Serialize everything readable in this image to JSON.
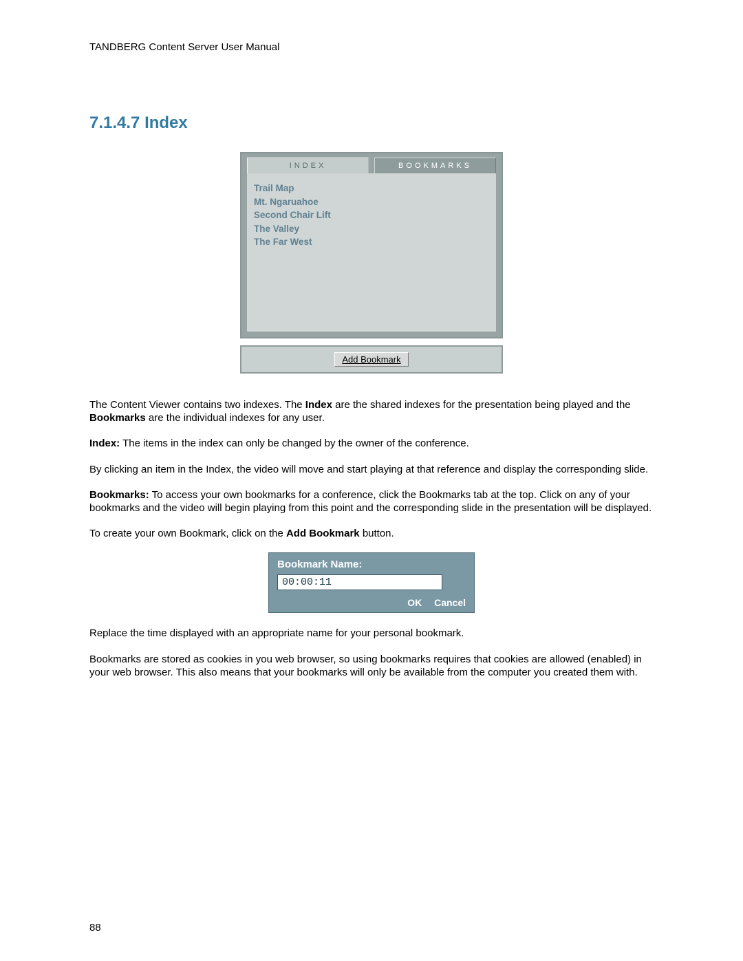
{
  "header": "TANDBERG Content Server User Manual",
  "section": {
    "number": "7.1.4.7",
    "title": "Index",
    "heading": "7.1.4.7  Index"
  },
  "index_panel": {
    "tabs": {
      "index": "INDEX",
      "bookmarks": "BOOKMARKS"
    },
    "items": [
      "Trail Map",
      "Mt. Ngaruahoe",
      "Second Chair Lift",
      "The Valley",
      "The Far West"
    ],
    "add_bookmark_label": "Add Bookmark"
  },
  "para1_a": "The Content Viewer contains two indexes. The ",
  "para1_b": "Index",
  "para1_c": " are the shared indexes for the presentation being played and the ",
  "para1_d": "Bookmarks",
  "para1_e": " are the individual indexes for any user.",
  "para2_a": "Index:",
  "para2_b": " The items in the index can only be changed by the owner of the conference.",
  "para3": "By clicking an item in the Index, the video will move and start playing at that reference and display the corresponding slide.",
  "para4_a": "Bookmarks:",
  "para4_b": " To access your own bookmarks for a conference, click the Bookmarks tab at the top. Click on any of your bookmarks and the video will begin playing from this point and the corresponding slide in the presentation will be displayed.",
  "para5_a": "To create your own Bookmark, click on the ",
  "para5_b": "Add Bookmark",
  "para5_c": " button.",
  "bookmark_dialog": {
    "label": "Bookmark Name:",
    "value": "00:00:11",
    "ok": "OK",
    "cancel": "Cancel"
  },
  "para6": "Replace the time displayed with an appropriate name for your personal bookmark.",
  "para7": "Bookmarks are stored as cookies in you web browser, so using bookmarks requires that cookies are allowed (enabled) in your web browser. This also means that your bookmarks will only be available from the computer you created them with.",
  "page_number": "88"
}
